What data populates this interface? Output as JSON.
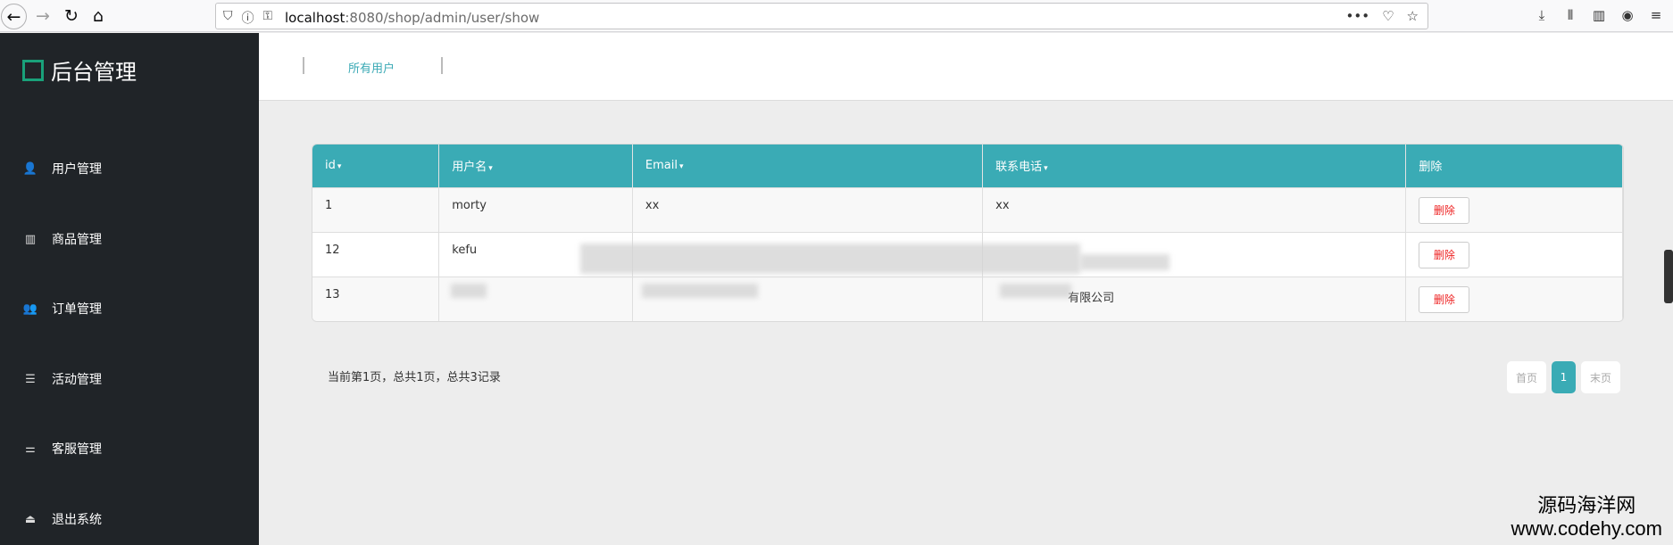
{
  "browser": {
    "url_host": "localhost",
    "url_path": ":8080/shop/admin/user/show",
    "icons": {
      "back": "←",
      "forward": "→",
      "reload": "↻",
      "home": "⌂",
      "shield": "⛉",
      "info": "ⓘ",
      "perm": "⚿",
      "more": "•••",
      "pocket": "♡",
      "star": "☆",
      "download": "⤓",
      "library": "⫴",
      "sidebar": "▥",
      "account": "◉",
      "menu": "≡"
    }
  },
  "sidebar": {
    "brand": "后台管理",
    "items": [
      {
        "label": "用户管理",
        "icon": "👤"
      },
      {
        "label": "商品管理",
        "icon": "▥"
      },
      {
        "label": "订单管理",
        "icon": "👥"
      },
      {
        "label": "活动管理",
        "icon": "☰"
      },
      {
        "label": "客服管理",
        "icon": "⚌"
      },
      {
        "label": "退出系统",
        "icon": "⏏"
      }
    ]
  },
  "topbar": {
    "tab_all_users": "所有用户"
  },
  "table": {
    "headers": [
      "id",
      "用户名",
      "Email",
      "联系电话",
      "删除"
    ],
    "sortable": [
      true,
      true,
      true,
      true,
      false
    ],
    "caret": "▾",
    "rows": [
      {
        "id": "1",
        "username": "morty",
        "email": "xx",
        "phone": "xx",
        "action": "删除"
      },
      {
        "id": "12",
        "username": "kefu",
        "email": "",
        "phone": "",
        "action": "删除"
      },
      {
        "id": "13",
        "username": "",
        "email": "",
        "phone": "有限公司",
        "action": "删除"
      }
    ]
  },
  "pagination": {
    "info": "当前第1页，总共1页，总共3记录",
    "first": "首页",
    "current": "1",
    "last": "末页"
  },
  "watermark": {
    "cn": "源码海洋网",
    "url": "www.codehy.com"
  },
  "colors": {
    "accent": "#3aabb5",
    "sidebar_bg": "#202428",
    "delete_text": "#e22222",
    "brand_logo": "#19a17a"
  }
}
